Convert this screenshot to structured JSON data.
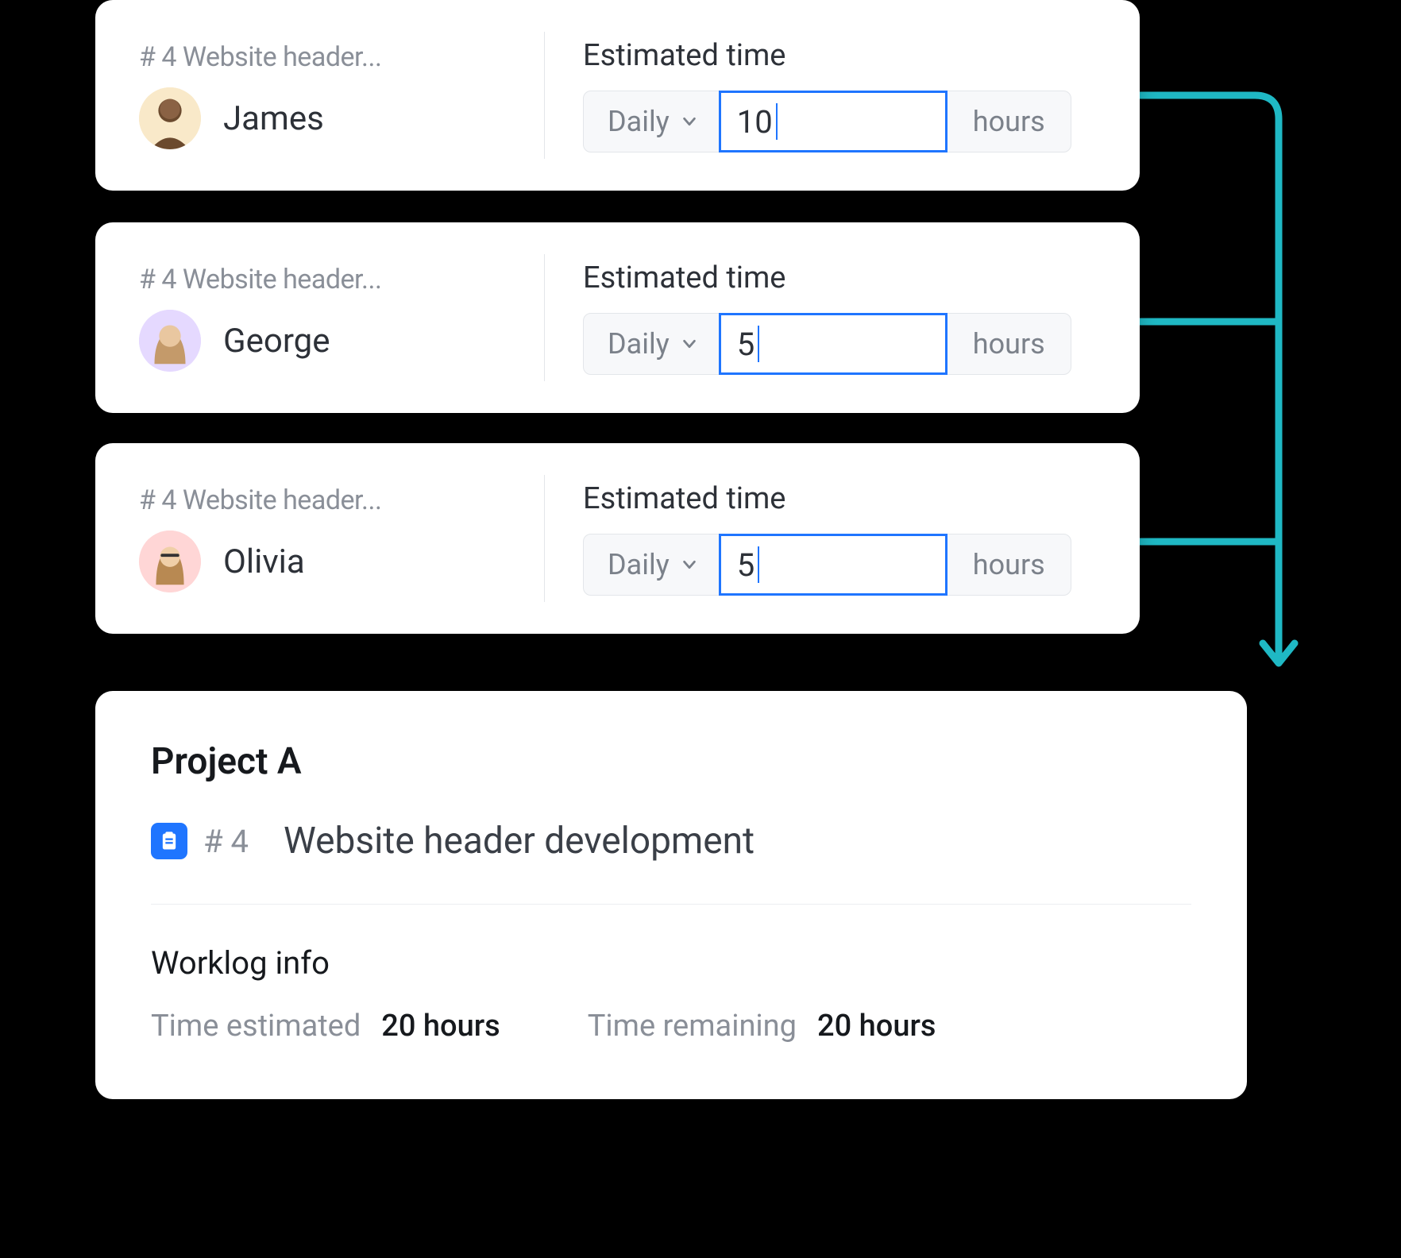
{
  "tasks": [
    {
      "title": "# 4 Website header...",
      "person": "James",
      "avatar_bg": "#f9e9c9",
      "est_label": "Estimated time",
      "freq": "Daily",
      "value": "10",
      "unit": "hours"
    },
    {
      "title": "# 4 Website header...",
      "person": "George",
      "avatar_bg": "#e5d9ff",
      "est_label": "Estimated time",
      "freq": "Daily",
      "value": "5",
      "unit": "hours"
    },
    {
      "title": "# 4 Website header...",
      "person": "Olivia",
      "avatar_bg": "#ffd6d6",
      "est_label": "Estimated time",
      "freq": "Daily",
      "value": "5",
      "unit": "hours"
    }
  ],
  "summary": {
    "project": "Project A",
    "task_id": "# 4",
    "task_name": "Website header development",
    "worklog_title": "Worklog info",
    "time_estimated_label": "Time estimated",
    "time_estimated_value": "20 hours",
    "time_remaining_label": "Time remaining",
    "time_remaining_value": "20 hours"
  },
  "colors": {
    "accent": "#1f75ff",
    "connector": "#1fb8c4"
  }
}
